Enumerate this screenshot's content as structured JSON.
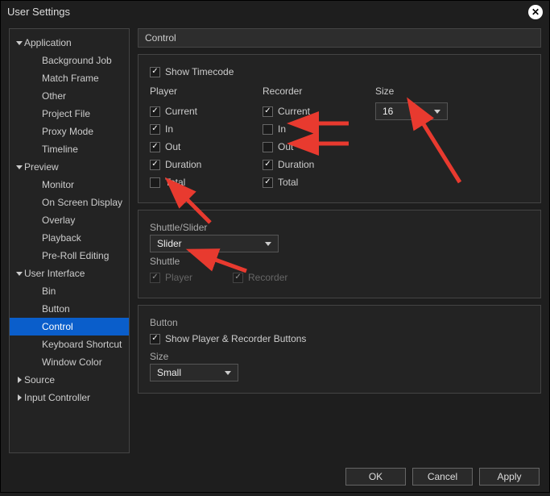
{
  "title": "User Settings",
  "sidebar": {
    "groups": [
      {
        "label": "Application",
        "children": [
          "Background Job",
          "Match Frame",
          "Other",
          "Project File",
          "Proxy Mode",
          "Timeline"
        ]
      },
      {
        "label": "Preview",
        "children": [
          "Monitor",
          "On Screen Display",
          "Overlay",
          "Playback",
          "Pre-Roll Editing"
        ]
      },
      {
        "label": "User Interface",
        "children": [
          "Bin",
          "Button",
          "Control",
          "Keyboard Shortcut",
          "Window Color"
        ]
      },
      {
        "label": "Source",
        "children": []
      },
      {
        "label": "Input Controller",
        "children": []
      }
    ],
    "selected": "Control"
  },
  "main_title": "Control",
  "timecode": {
    "show_label": "Show Timecode",
    "show_checked": true,
    "player_head": "Player",
    "recorder_head": "Recorder",
    "size_head": "Size",
    "size_value": "16",
    "player": [
      {
        "label": "Current",
        "checked": true
      },
      {
        "label": "In",
        "checked": true
      },
      {
        "label": "Out",
        "checked": true
      },
      {
        "label": "Duration",
        "checked": true
      },
      {
        "label": "Total",
        "checked": false
      }
    ],
    "recorder": [
      {
        "label": "Current",
        "checked": true
      },
      {
        "label": "In",
        "checked": false
      },
      {
        "label": "Out",
        "checked": false
      },
      {
        "label": "Duration",
        "checked": true
      },
      {
        "label": "Total",
        "checked": true
      }
    ]
  },
  "shuttle": {
    "head": "Shuttle/Slider",
    "select_value": "Slider",
    "sub_head": "Shuttle",
    "player_label": "Player",
    "player_checked": true,
    "recorder_label": "Recorder",
    "recorder_checked": true,
    "disabled": true
  },
  "button_panel": {
    "head": "Button",
    "show_label": "Show Player & Recorder Buttons",
    "show_checked": true,
    "size_label": "Size",
    "size_value": "Small"
  },
  "footer": {
    "ok": "OK",
    "cancel": "Cancel",
    "apply": "Apply"
  }
}
